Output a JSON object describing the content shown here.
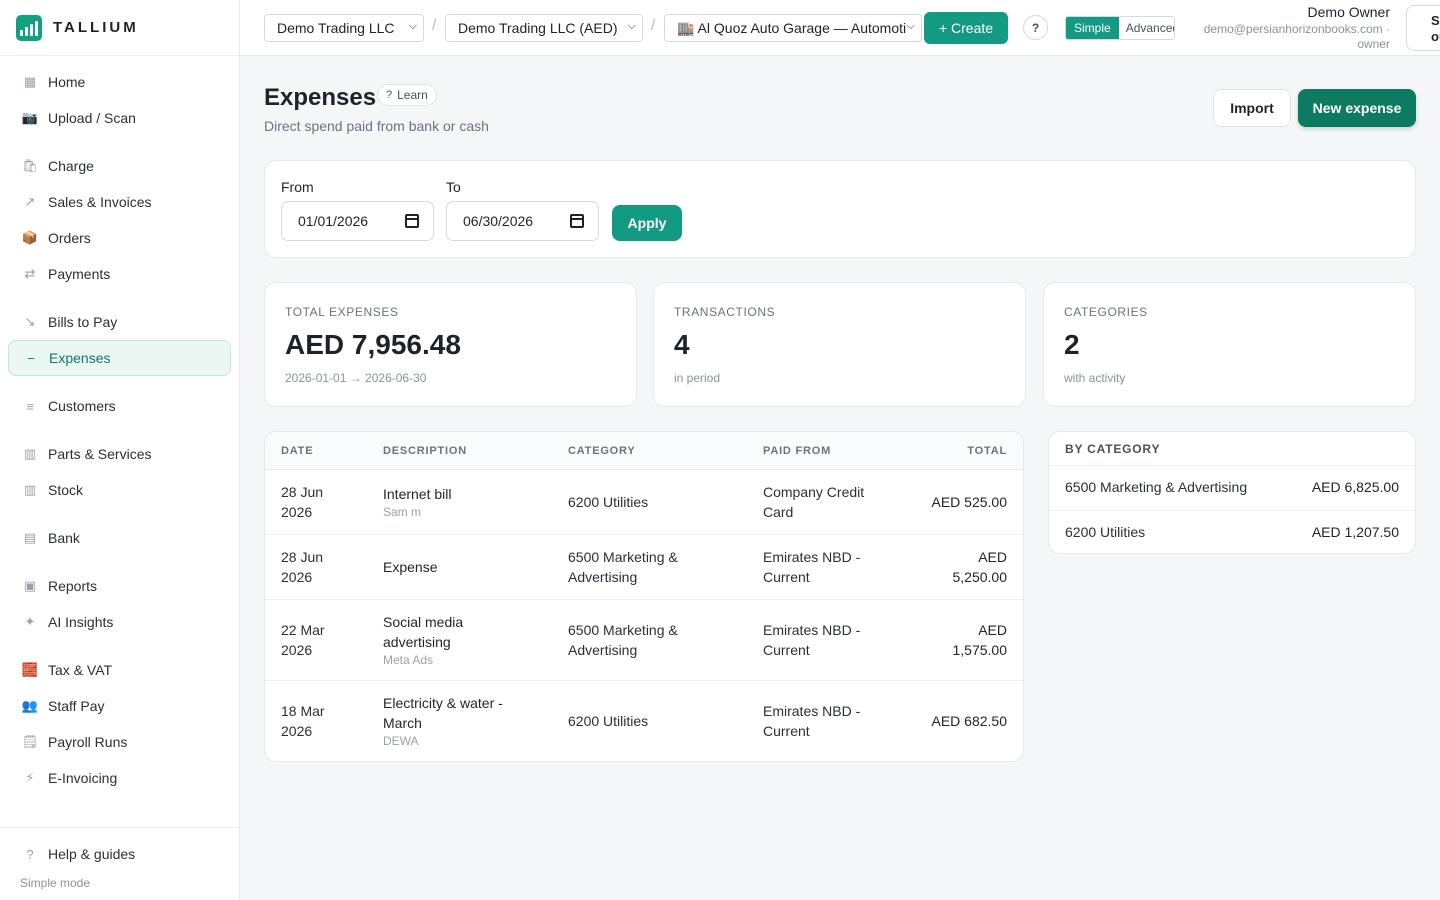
{
  "brand": {
    "name": "TALLIUM"
  },
  "sidebar": {
    "items": [
      {
        "label": "Home",
        "icon": "▦"
      },
      {
        "label": "Upload / Scan",
        "icon": "📷"
      },
      {
        "label": "Charge",
        "icon": "🛍"
      },
      {
        "label": "Sales & Invoices",
        "icon": "↗"
      },
      {
        "label": "Orders",
        "icon": "📦"
      },
      {
        "label": "Payments",
        "icon": "⇄"
      },
      {
        "label": "Bills to Pay",
        "icon": "↘"
      },
      {
        "label": "Expenses",
        "icon": "−"
      },
      {
        "label": "Customers",
        "icon": "≡"
      },
      {
        "label": "Parts & Services",
        "icon": "▥"
      },
      {
        "label": "Stock",
        "icon": "▥"
      },
      {
        "label": "Bank",
        "icon": "▤"
      },
      {
        "label": "Reports",
        "icon": "▣"
      },
      {
        "label": "AI Insights",
        "icon": "✦"
      },
      {
        "label": "Tax & VAT",
        "icon": "🧱"
      },
      {
        "label": "Staff Pay",
        "icon": "👥"
      },
      {
        "label": "Payroll Runs",
        "icon": "🗒"
      },
      {
        "label": "E-Invoicing",
        "icon": "⚡"
      }
    ],
    "footer": {
      "help_label": "Help & guides",
      "help_icon": "?",
      "mode_label": "Simple mode"
    }
  },
  "topbar": {
    "company": "Demo Trading LLC",
    "entity": "Demo Trading LLC (AED)",
    "branch": "🏬 Al Quoz Auto Garage — Automoti",
    "create_label": "+ Create",
    "help": "?",
    "mode_simple": "Simple",
    "mode_advanced": "Advanced",
    "user_name": "Demo Owner",
    "user_email": "demo@persianhorizonbooks.com ·",
    "user_role": "owner",
    "signout_label": "Sign out"
  },
  "page": {
    "title": "Expenses",
    "learn_label": "Learn",
    "subtitle": "Direct spend paid from bank or cash",
    "import_label": "Import",
    "new_label": "New expense"
  },
  "filters": {
    "from_label": "From",
    "from_value": "01/01/2026",
    "to_label": "To",
    "to_value": "06/30/2026",
    "apply_label": "Apply"
  },
  "stats": [
    {
      "label": "TOTAL EXPENSES",
      "value": "AED 7,956.48",
      "hint": "2026-01-01 → 2026-06-30"
    },
    {
      "label": "TRANSACTIONS",
      "value": "4",
      "hint": "in period"
    },
    {
      "label": "CATEGORIES",
      "value": "2",
      "hint": "with activity"
    }
  ],
  "table": {
    "headers": {
      "date": "DATE",
      "description": "DESCRIPTION",
      "category": "CATEGORY",
      "paid_from": "PAID FROM",
      "total": "TOTAL"
    },
    "rows": [
      {
        "date_a": "28 Jun",
        "date_b": "2026",
        "desc_a": "Internet bill",
        "desc_b": "",
        "desc_sub": "Sam m",
        "cat_a": "6200 Utilities",
        "cat_b": "",
        "paid_a": "Company Credit",
        "paid_b": "Card",
        "total_a": "AED 525.00",
        "total_b": ""
      },
      {
        "date_a": "28 Jun",
        "date_b": "2026",
        "desc_a": "Expense",
        "desc_b": "",
        "desc_sub": "",
        "cat_a": "6500 Marketing &",
        "cat_b": "Advertising",
        "paid_a": "Emirates NBD -",
        "paid_b": "Current",
        "total_a": "AED",
        "total_b": "5,250.00"
      },
      {
        "date_a": "22 Mar",
        "date_b": "2026",
        "desc_a": "Social media",
        "desc_b": "advertising",
        "desc_sub": "Meta Ads",
        "cat_a": "6500 Marketing &",
        "cat_b": "Advertising",
        "paid_a": "Emirates NBD -",
        "paid_b": "Current",
        "total_a": "AED",
        "total_b": "1,575.00"
      },
      {
        "date_a": "18 Mar",
        "date_b": "2026",
        "desc_a": "Electricity & water -",
        "desc_b": "March",
        "desc_sub": "DEWA",
        "cat_a": "6200 Utilities",
        "cat_b": "",
        "paid_a": "Emirates NBD -",
        "paid_b": "Current",
        "total_a": "AED 682.50",
        "total_b": ""
      }
    ]
  },
  "by_category": {
    "title": "BY CATEGORY",
    "rows": [
      {
        "name": "6500 Marketing & Advertising",
        "amount": "AED 6,825.00"
      },
      {
        "name": "6200 Utilities",
        "amount": "AED 1,207.50"
      }
    ]
  },
  "colors": {
    "accent": "#129a83",
    "accent_dark": "#0f7a62",
    "active_bg": "#eaf7f3"
  }
}
